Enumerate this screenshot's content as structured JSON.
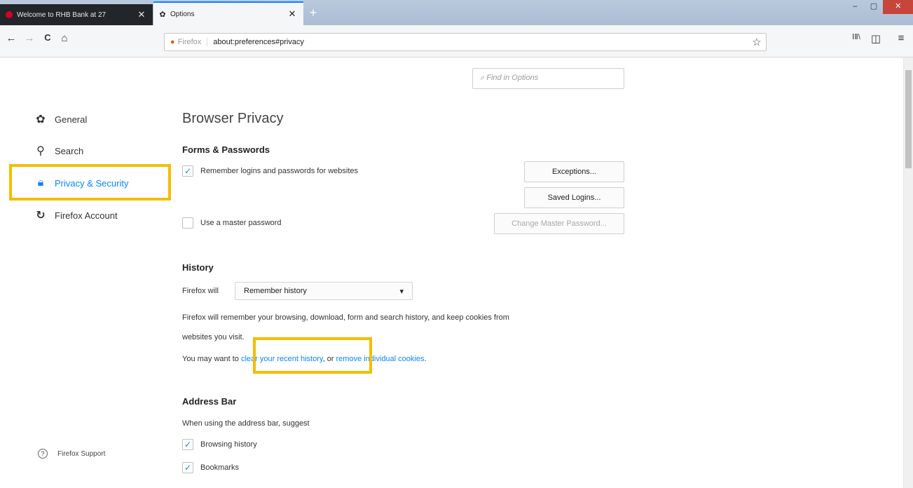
{
  "tabs": [
    {
      "title": "Welcome to RHB Bank at 27",
      "close": "✕"
    },
    {
      "title": "Options",
      "close": "✕"
    }
  ],
  "newtab_symbol": "+",
  "window_controls": {
    "minimize": "–",
    "maximize": "▢",
    "close": "✕"
  },
  "nav": {
    "back": "←",
    "forward": "→",
    "reload": "C",
    "home": "⌂"
  },
  "urlbar": {
    "identity": "Firefox",
    "url": "about:preferences#privacy",
    "bookmark_star": "☆"
  },
  "toolbar_right": {
    "library": "ⅠⅡ\\",
    "sidebar": "◫",
    "menu": "≡"
  },
  "find_placeholder": "Find in Options",
  "categories": [
    {
      "label": "General",
      "icon": "gear-icon"
    },
    {
      "label": "Search",
      "icon": "search-icon"
    },
    {
      "label": "Privacy & Security",
      "icon": "lock-icon",
      "selected": true
    },
    {
      "label": "Firefox Account",
      "icon": "sync-icon"
    }
  ],
  "support_label": "Firefox Support",
  "page_title": "Browser Privacy",
  "forms": {
    "heading": "Forms & Passwords",
    "remember_logins": {
      "label": "Remember logins and passwords for websites",
      "checked": true
    },
    "master_password": {
      "label": "Use a master password",
      "checked": false
    },
    "exceptions_btn": "Exceptions...",
    "saved_logins_btn": "Saved Logins...",
    "change_master_btn": "Change Master Password..."
  },
  "history": {
    "heading": "History",
    "firefox_will_label": "Firefox will",
    "selected_option": "Remember history",
    "desc_line1": "Firefox will remember your browsing, download, form and search history, and keep cookies from",
    "desc_line2": "websites you visit.",
    "may_want_prefix": "You may want to ",
    "clear_link": "clear your recent history",
    "or_text": ", or ",
    "cookies_link": "remove individual cookies",
    "period": "."
  },
  "address_bar": {
    "heading": "Address Bar",
    "suggest_label": "When using the address bar, suggest",
    "options": [
      {
        "label": "Browsing history",
        "checked": true
      },
      {
        "label": "Bookmarks",
        "checked": true
      }
    ]
  },
  "colors": {
    "accent": "#0a84ff",
    "highlight": "#f5bd00"
  }
}
